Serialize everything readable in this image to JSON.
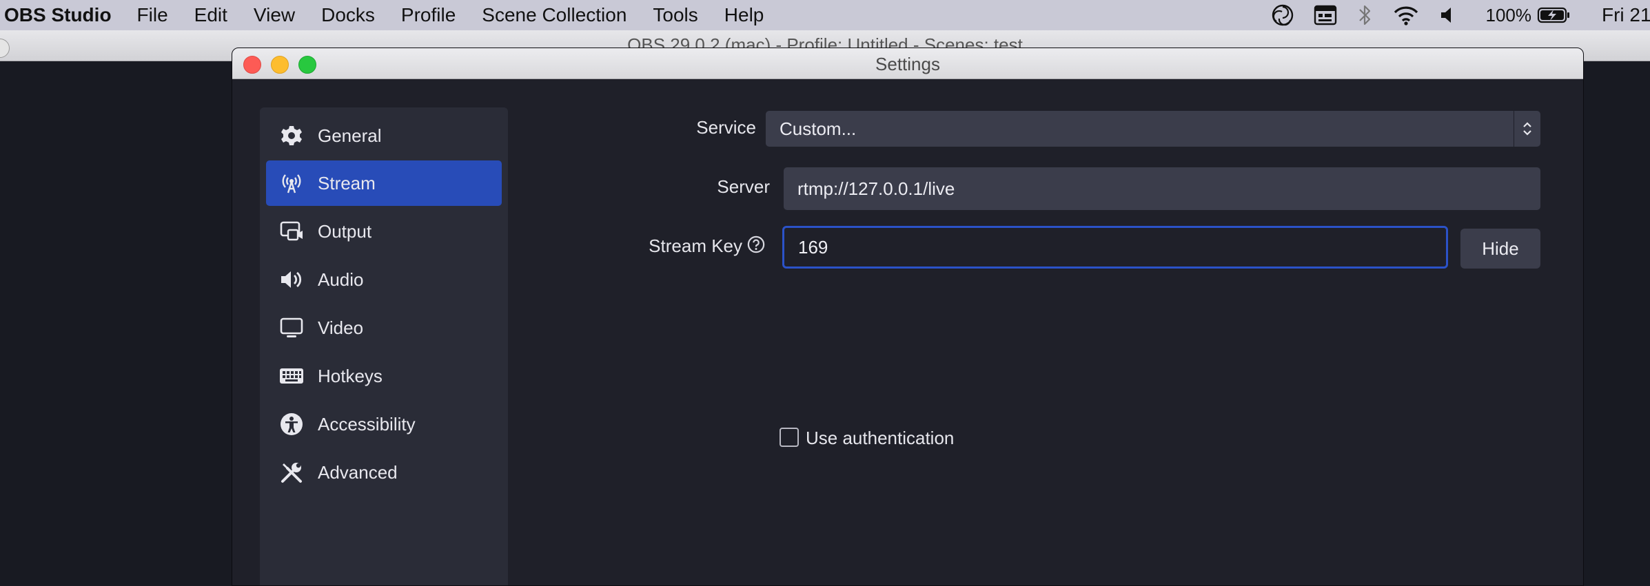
{
  "menubar": {
    "app_name": "OBS Studio",
    "menus": [
      "File",
      "Edit",
      "View",
      "Docks",
      "Profile",
      "Scene Collection",
      "Tools",
      "Help"
    ],
    "battery": "100%",
    "clock": "Fri 21"
  },
  "main_window": {
    "title": "OBS 29.0.2 (mac) - Profile: Untitled - Scenes: test"
  },
  "settings_window": {
    "title": "Settings",
    "sidebar": {
      "items": [
        {
          "label": "General",
          "icon": "gear-icon"
        },
        {
          "label": "Stream",
          "icon": "antenna-icon",
          "active": true
        },
        {
          "label": "Output",
          "icon": "output-icon"
        },
        {
          "label": "Audio",
          "icon": "speaker-icon"
        },
        {
          "label": "Video",
          "icon": "monitor-icon"
        },
        {
          "label": "Hotkeys",
          "icon": "keyboard-icon"
        },
        {
          "label": "Accessibility",
          "icon": "accessibility-icon"
        },
        {
          "label": "Advanced",
          "icon": "tools-icon"
        }
      ]
    },
    "stream": {
      "service_label": "Service",
      "service_value": "Custom...",
      "server_label": "Server",
      "server_value": "rtmp://127.0.0.1/live",
      "stream_key_label": "Stream Key",
      "stream_key_value": "169",
      "hide_button": "Hide",
      "use_auth_label": "Use authentication",
      "use_auth_checked": false
    }
  },
  "colors": {
    "accent": "#284cb8",
    "focus_border": "#2b52c8",
    "panel": "#2a2c37",
    "background": "#1f2029"
  }
}
